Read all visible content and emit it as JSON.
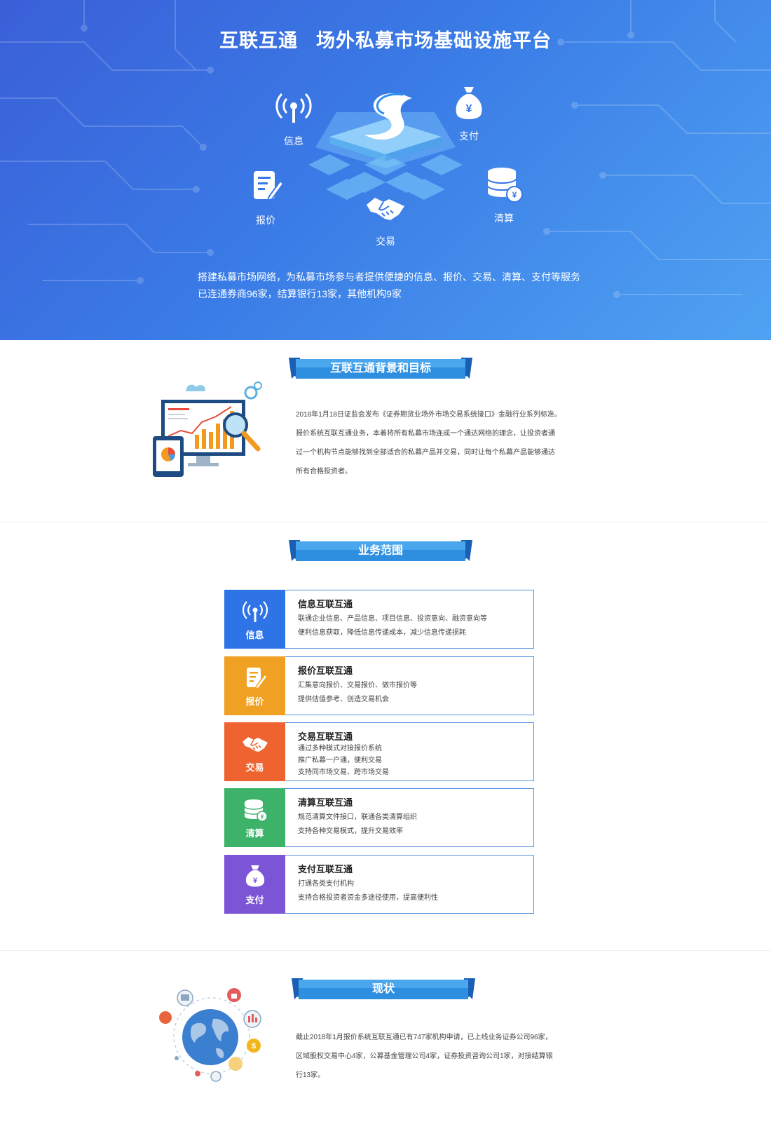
{
  "hero": {
    "title_part1": "互联互通",
    "title_part2": "场外私募市场基础设施平台",
    "nodes": {
      "info": "信息",
      "pay": "支付",
      "quote": "报价",
      "clear": "清算",
      "trade": "交易"
    },
    "desc_line1": "搭建私募市场网络，为私募市场参与者提供便捷的信息、报价、交易、清算、支付等服务",
    "desc_line2": "已连通券商96家，结算银行13家，其他机构9家"
  },
  "background": {
    "heading": "互联互通背景和目标",
    "lines": [
      "2018年1月18日证监会发布《证券期货业场外市场交易系统接口》金融行业系列标准。",
      "报价系统互联互通业务，本着将所有私募市场连成一个通达网络的理念，让投资者通",
      "过一个机构节点能够找到全部适合的私募产品并交易，同时让每个私募产品能够通达",
      "所有合格投资者。"
    ]
  },
  "scope": {
    "heading": "业务范围",
    "items": [
      {
        "tile": "信息",
        "title": "信息互联互通",
        "lines": [
          "联通企业信息、产品信息、项目信息、投资意向、融资意向等",
          "便利信息获取，降低信息传递成本，减少信息传递损耗"
        ],
        "color": "#2f74e6"
      },
      {
        "tile": "报价",
        "title": "报价互联互通",
        "lines": [
          "汇集意向报价、交易报价、做市报价等",
          "提供估值参考、创造交易机会"
        ],
        "color": "#f0a022"
      },
      {
        "tile": "交易",
        "title": "交易互联互通",
        "lines": [
          "通过多种模式对接报价系统",
          "推广私募一户通，便利交易",
          "支持同市场交易、跨市场交易"
        ],
        "color": "#ee6330"
      },
      {
        "tile": "清算",
        "title": "清算互联互通",
        "lines": [
          "规范清算文件接口，联通各类清算组织",
          "支持各种交易模式，提升交易效率"
        ],
        "color": "#3db36a"
      },
      {
        "tile": "支付",
        "title": "支付互联互通",
        "lines": [
          "打通各类支付机构",
          "支持合格投资者资金多途径使用，提高便利性"
        ],
        "color": "#7c55d6"
      }
    ]
  },
  "status": {
    "heading": "现状",
    "lines": [
      "截止2018年1月报价系统互联互通已有747家机构申请，已上线业务证券公司96家，",
      "区域股权交易中心4家，公募基金管理公司4家，证券投资咨询公司1家，对接结算银",
      "行13家。"
    ]
  },
  "colors": {
    "hero_start": "#3a5fd8",
    "hero_end": "#4fa2f2",
    "banner": "#2e8fe0",
    "item_border": "#5b8fe0"
  },
  "icons": {
    "info": "signal-icon",
    "pay": "money-bag-icon",
    "quote": "document-pen-icon",
    "clear": "database-coin-icon",
    "trade": "handshake-icon"
  }
}
